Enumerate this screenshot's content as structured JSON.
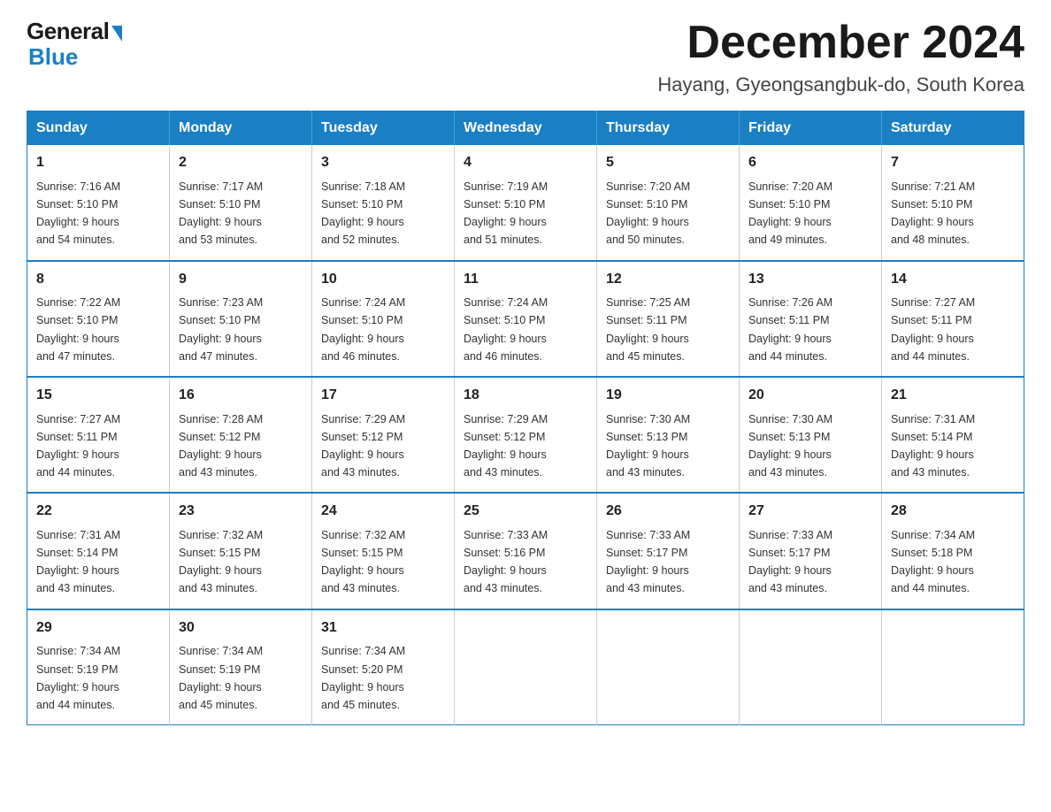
{
  "logo": {
    "general": "General",
    "blue": "Blue"
  },
  "title": "December 2024",
  "location": "Hayang, Gyeongsangbuk-do, South Korea",
  "weekdays": [
    "Sunday",
    "Monday",
    "Tuesday",
    "Wednesday",
    "Thursday",
    "Friday",
    "Saturday"
  ],
  "weeks": [
    [
      {
        "day": "1",
        "sunrise": "7:16 AM",
        "sunset": "5:10 PM",
        "daylight": "9 hours and 54 minutes."
      },
      {
        "day": "2",
        "sunrise": "7:17 AM",
        "sunset": "5:10 PM",
        "daylight": "9 hours and 53 minutes."
      },
      {
        "day": "3",
        "sunrise": "7:18 AM",
        "sunset": "5:10 PM",
        "daylight": "9 hours and 52 minutes."
      },
      {
        "day": "4",
        "sunrise": "7:19 AM",
        "sunset": "5:10 PM",
        "daylight": "9 hours and 51 minutes."
      },
      {
        "day": "5",
        "sunrise": "7:20 AM",
        "sunset": "5:10 PM",
        "daylight": "9 hours and 50 minutes."
      },
      {
        "day": "6",
        "sunrise": "7:20 AM",
        "sunset": "5:10 PM",
        "daylight": "9 hours and 49 minutes."
      },
      {
        "day": "7",
        "sunrise": "7:21 AM",
        "sunset": "5:10 PM",
        "daylight": "9 hours and 48 minutes."
      }
    ],
    [
      {
        "day": "8",
        "sunrise": "7:22 AM",
        "sunset": "5:10 PM",
        "daylight": "9 hours and 47 minutes."
      },
      {
        "day": "9",
        "sunrise": "7:23 AM",
        "sunset": "5:10 PM",
        "daylight": "9 hours and 47 minutes."
      },
      {
        "day": "10",
        "sunrise": "7:24 AM",
        "sunset": "5:10 PM",
        "daylight": "9 hours and 46 minutes."
      },
      {
        "day": "11",
        "sunrise": "7:24 AM",
        "sunset": "5:10 PM",
        "daylight": "9 hours and 46 minutes."
      },
      {
        "day": "12",
        "sunrise": "7:25 AM",
        "sunset": "5:11 PM",
        "daylight": "9 hours and 45 minutes."
      },
      {
        "day": "13",
        "sunrise": "7:26 AM",
        "sunset": "5:11 PM",
        "daylight": "9 hours and 44 minutes."
      },
      {
        "day": "14",
        "sunrise": "7:27 AM",
        "sunset": "5:11 PM",
        "daylight": "9 hours and 44 minutes."
      }
    ],
    [
      {
        "day": "15",
        "sunrise": "7:27 AM",
        "sunset": "5:11 PM",
        "daylight": "9 hours and 44 minutes."
      },
      {
        "day": "16",
        "sunrise": "7:28 AM",
        "sunset": "5:12 PM",
        "daylight": "9 hours and 43 minutes."
      },
      {
        "day": "17",
        "sunrise": "7:29 AM",
        "sunset": "5:12 PM",
        "daylight": "9 hours and 43 minutes."
      },
      {
        "day": "18",
        "sunrise": "7:29 AM",
        "sunset": "5:12 PM",
        "daylight": "9 hours and 43 minutes."
      },
      {
        "day": "19",
        "sunrise": "7:30 AM",
        "sunset": "5:13 PM",
        "daylight": "9 hours and 43 minutes."
      },
      {
        "day": "20",
        "sunrise": "7:30 AM",
        "sunset": "5:13 PM",
        "daylight": "9 hours and 43 minutes."
      },
      {
        "day": "21",
        "sunrise": "7:31 AM",
        "sunset": "5:14 PM",
        "daylight": "9 hours and 43 minutes."
      }
    ],
    [
      {
        "day": "22",
        "sunrise": "7:31 AM",
        "sunset": "5:14 PM",
        "daylight": "9 hours and 43 minutes."
      },
      {
        "day": "23",
        "sunrise": "7:32 AM",
        "sunset": "5:15 PM",
        "daylight": "9 hours and 43 minutes."
      },
      {
        "day": "24",
        "sunrise": "7:32 AM",
        "sunset": "5:15 PM",
        "daylight": "9 hours and 43 minutes."
      },
      {
        "day": "25",
        "sunrise": "7:33 AM",
        "sunset": "5:16 PM",
        "daylight": "9 hours and 43 minutes."
      },
      {
        "day": "26",
        "sunrise": "7:33 AM",
        "sunset": "5:17 PM",
        "daylight": "9 hours and 43 minutes."
      },
      {
        "day": "27",
        "sunrise": "7:33 AM",
        "sunset": "5:17 PM",
        "daylight": "9 hours and 43 minutes."
      },
      {
        "day": "28",
        "sunrise": "7:34 AM",
        "sunset": "5:18 PM",
        "daylight": "9 hours and 44 minutes."
      }
    ],
    [
      {
        "day": "29",
        "sunrise": "7:34 AM",
        "sunset": "5:19 PM",
        "daylight": "9 hours and 44 minutes."
      },
      {
        "day": "30",
        "sunrise": "7:34 AM",
        "sunset": "5:19 PM",
        "daylight": "9 hours and 45 minutes."
      },
      {
        "day": "31",
        "sunrise": "7:34 AM",
        "sunset": "5:20 PM",
        "daylight": "9 hours and 45 minutes."
      },
      null,
      null,
      null,
      null
    ]
  ],
  "labels": {
    "sunrise": "Sunrise:",
    "sunset": "Sunset:",
    "daylight": "Daylight:"
  }
}
